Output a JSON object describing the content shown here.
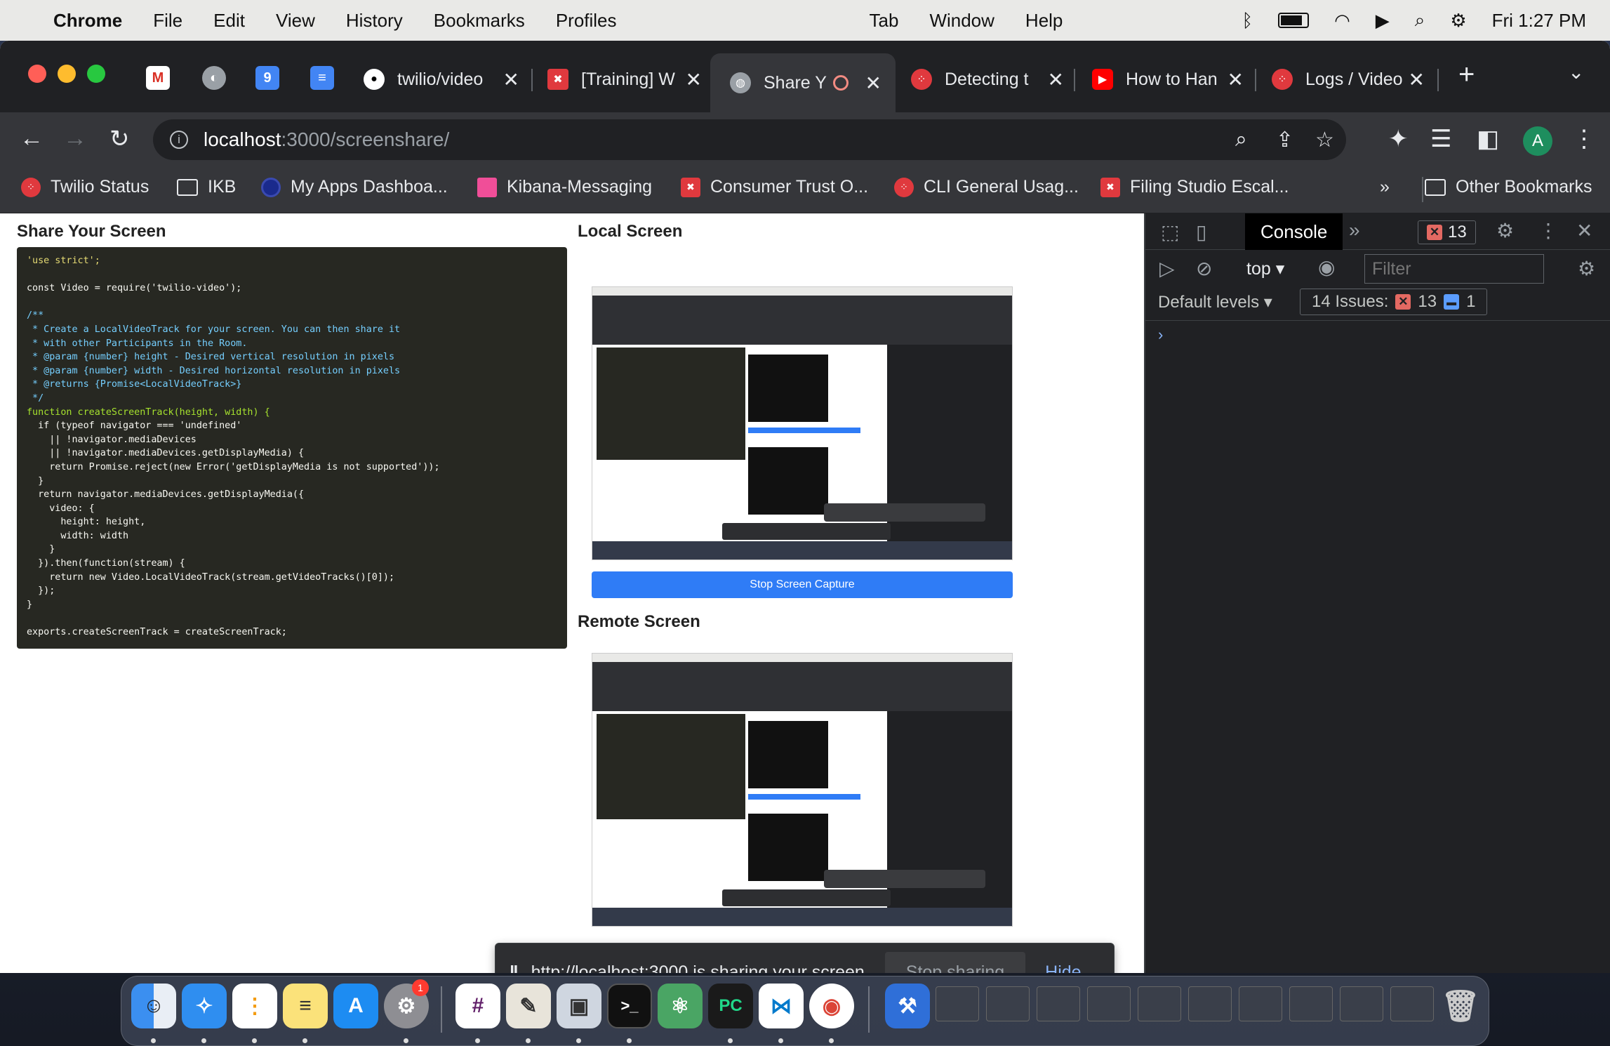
{
  "menubar": {
    "app": "Chrome",
    "items": [
      "File",
      "Edit",
      "View",
      "History",
      "Bookmarks",
      "Profiles",
      "Tab",
      "Window",
      "Help"
    ],
    "clock": "Fri  1:27 PM"
  },
  "tabs": [
    {
      "title": "twilio/video",
      "icon": "github"
    },
    {
      "title": "[Training] W",
      "icon": "twilio-red"
    },
    {
      "title": "Share Y",
      "icon": "globe",
      "active": true
    },
    {
      "title": "Detecting t",
      "icon": "twilio"
    },
    {
      "title": "How to Han",
      "icon": "youtube"
    },
    {
      "title": "Logs / Video",
      "icon": "twilio"
    }
  ],
  "address": {
    "host": "localhost",
    "path": ":3000/screenshare/"
  },
  "avatar": "A",
  "bookmarks": [
    "Twilio Status",
    "IKB",
    "My Apps Dashboa...",
    "Kibana-Messaging",
    "Consumer Trust O...",
    "CLI General Usag...",
    "Filing Studio Escal..."
  ],
  "other_bookmarks": "Other Bookmarks",
  "page": {
    "share_heading": "Share Your Screen",
    "local_heading": "Local Screen",
    "remote_heading": "Remote Screen",
    "stop_button": "Stop Screen Capture"
  },
  "code_lines": [
    {
      "t": "'use strict';",
      "c": "s"
    },
    {
      "t": "",
      "c": "n"
    },
    {
      "t": "const Video = require('twilio-video');",
      "c": "n"
    },
    {
      "t": "",
      "c": "n"
    },
    {
      "t": "/**",
      "c": "cm"
    },
    {
      "t": " * Create a LocalVideoTrack for your screen. You can then share it",
      "c": "cm"
    },
    {
      "t": " * with other Participants in the Room.",
      "c": "cm"
    },
    {
      "t": " * @param {number} height - Desired vertical resolution in pixels",
      "c": "cm"
    },
    {
      "t": " * @param {number} width - Desired horizontal resolution in pixels",
      "c": "cm"
    },
    {
      "t": " * @returns {Promise<LocalVideoTrack>}",
      "c": "cm"
    },
    {
      "t": " */",
      "c": "cm"
    },
    {
      "t": "function createScreenTrack(height, width) {",
      "c": "f"
    },
    {
      "t": "  if (typeof navigator === 'undefined'",
      "c": "n"
    },
    {
      "t": "    || !navigator.mediaDevices",
      "c": "n"
    },
    {
      "t": "    || !navigator.mediaDevices.getDisplayMedia) {",
      "c": "n"
    },
    {
      "t": "    return Promise.reject(new Error('getDisplayMedia is not supported'));",
      "c": "n"
    },
    {
      "t": "  }",
      "c": "n"
    },
    {
      "t": "  return navigator.mediaDevices.getDisplayMedia({",
      "c": "n"
    },
    {
      "t": "    video: {",
      "c": "n"
    },
    {
      "t": "      height: height,",
      "c": "n"
    },
    {
      "t": "      width: width",
      "c": "n"
    },
    {
      "t": "    }",
      "c": "n"
    },
    {
      "t": "  }).then(function(stream) {",
      "c": "n"
    },
    {
      "t": "    return new Video.LocalVideoTrack(stream.getVideoTracks()[0]);",
      "c": "n"
    },
    {
      "t": "  });",
      "c": "n"
    },
    {
      "t": "}",
      "c": "n"
    },
    {
      "t": "",
      "c": "n"
    },
    {
      "t": "exports.createScreenTrack = createScreenTrack;",
      "c": "n"
    }
  ],
  "share_bar": {
    "message": "http://localhost:3000 is sharing your screen.",
    "stop": "Stop sharing",
    "hide": "Hide"
  },
  "devtools": {
    "tab": "Console",
    "error_count": "13",
    "context": "top",
    "filter_placeholder": "Filter",
    "levels": "Default levels",
    "issues_label": "14 Issues:",
    "issues_errors": "13",
    "issues_info": "1"
  },
  "dock_badges": {
    "settings": "1"
  }
}
